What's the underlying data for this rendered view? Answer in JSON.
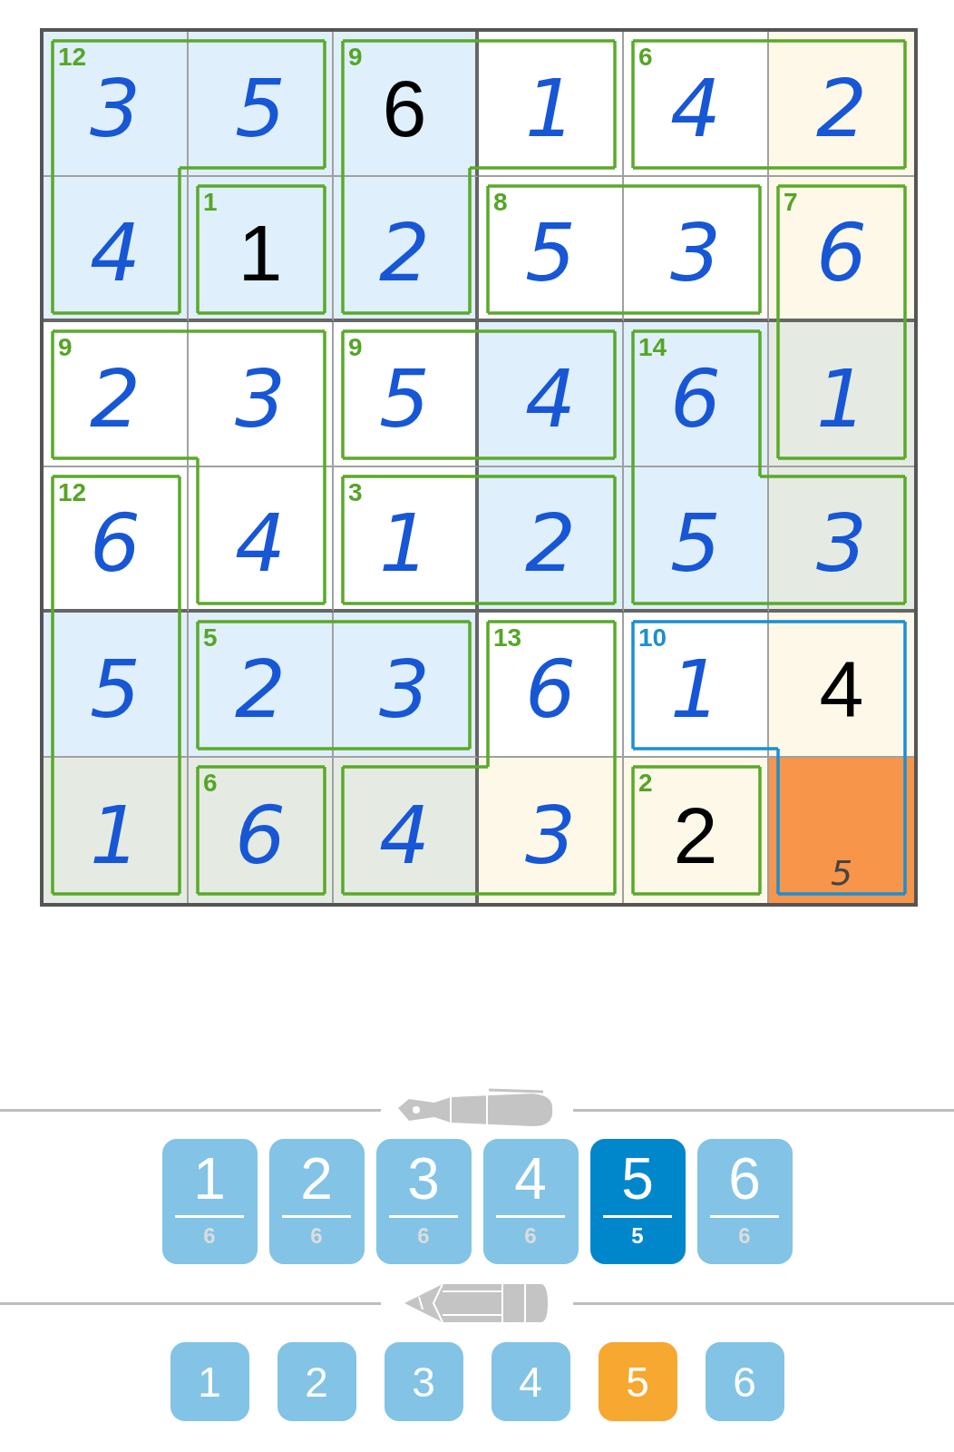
{
  "grid": {
    "rows": [
      [
        {
          "value": "3",
          "kind": "entry",
          "color": "#dfeffb",
          "cage_sum": "12",
          "joins_right": true,
          "joins_down": true,
          "cage_highlighted": false
        },
        {
          "value": "5",
          "kind": "entry",
          "color": "#dfeffb",
          "joins_right": false,
          "joins_down": false,
          "cage_highlighted": false
        },
        {
          "value": "6",
          "kind": "given",
          "color": "#dfeffb",
          "cage_sum": "9",
          "joins_right": true,
          "joins_down": true,
          "cage_highlighted": false
        },
        {
          "value": "1",
          "kind": "entry",
          "color": "#ffffff",
          "joins_right": false,
          "joins_down": false,
          "cage_highlighted": false
        },
        {
          "value": "4",
          "kind": "entry",
          "color": "#ffffff",
          "cage_sum": "6",
          "joins_right": true,
          "joins_down": false,
          "cage_highlighted": false
        },
        {
          "value": "2",
          "kind": "entry",
          "color": "#fdf8e8",
          "joins_down": false,
          "cage_highlighted": false
        }
      ],
      [
        {
          "value": "4",
          "kind": "entry",
          "color": "#dfeffb",
          "joins_right": false,
          "joins_down": false,
          "cage_highlighted": false
        },
        {
          "value": "1",
          "kind": "given",
          "color": "#dfeffb",
          "cage_sum": "1",
          "joins_right": false,
          "joins_down": false,
          "cage_highlighted": false
        },
        {
          "value": "2",
          "kind": "entry",
          "color": "#dfeffb",
          "joins_right": false,
          "joins_down": false,
          "cage_highlighted": false
        },
        {
          "value": "5",
          "kind": "entry",
          "color": "#ffffff",
          "cage_sum": "8",
          "joins_right": true,
          "joins_down": false,
          "cage_highlighted": false
        },
        {
          "value": "3",
          "kind": "entry",
          "color": "#ffffff",
          "joins_right": false,
          "joins_down": false,
          "cage_highlighted": false
        },
        {
          "value": "6",
          "kind": "entry",
          "color": "#fdf8e8",
          "cage_sum": "7",
          "joins_down": true,
          "cage_highlighted": false
        }
      ],
      [
        {
          "value": "2",
          "kind": "entry",
          "color": "#ffffff",
          "cage_sum": "9",
          "joins_right": true,
          "joins_down": false,
          "cage_highlighted": false
        },
        {
          "value": "3",
          "kind": "entry",
          "color": "#ffffff",
          "joins_right": false,
          "joins_down": true,
          "cage_highlighted": false
        },
        {
          "value": "5",
          "kind": "entry",
          "color": "#ffffff",
          "cage_sum": "9",
          "joins_right": true,
          "joins_down": false,
          "cage_highlighted": false
        },
        {
          "value": "4",
          "kind": "entry",
          "color": "#dfeffb",
          "joins_right": false,
          "joins_down": false,
          "cage_highlighted": false
        },
        {
          "value": "6",
          "kind": "entry",
          "color": "#dfeffb",
          "cage_sum": "14",
          "joins_right": false,
          "joins_down": true,
          "cage_highlighted": false
        },
        {
          "value": "1",
          "kind": "entry",
          "color": "#e5ebe3",
          "joins_down": false,
          "cage_highlighted": false
        }
      ],
      [
        {
          "value": "6",
          "kind": "entry",
          "color": "#ffffff",
          "cage_sum": "12",
          "joins_right": false,
          "joins_down": true,
          "cage_highlighted": false
        },
        {
          "value": "4",
          "kind": "entry",
          "color": "#ffffff",
          "joins_right": false,
          "joins_down": false,
          "cage_highlighted": false
        },
        {
          "value": "1",
          "kind": "entry",
          "color": "#ffffff",
          "cage_sum": "3",
          "joins_right": true,
          "joins_down": false,
          "cage_highlighted": false
        },
        {
          "value": "2",
          "kind": "entry",
          "color": "#dfeffb",
          "joins_right": false,
          "joins_down": false,
          "cage_highlighted": false
        },
        {
          "value": "5",
          "kind": "entry",
          "color": "#dfeffb",
          "joins_right": true,
          "joins_down": false,
          "cage_highlighted": false
        },
        {
          "value": "3",
          "kind": "entry",
          "color": "#e5ebe3",
          "joins_down": false,
          "cage_highlighted": false
        }
      ],
      [
        {
          "value": "5",
          "kind": "entry",
          "color": "#dfeffb",
          "joins_right": false,
          "joins_down": true,
          "cage_highlighted": false
        },
        {
          "value": "2",
          "kind": "entry",
          "color": "#dfeffb",
          "cage_sum": "5",
          "joins_right": true,
          "joins_down": false,
          "cage_highlighted": false
        },
        {
          "value": "3",
          "kind": "entry",
          "color": "#dfeffb",
          "joins_right": false,
          "joins_down": false,
          "cage_highlighted": false
        },
        {
          "value": "6",
          "kind": "entry",
          "color": "#ffffff",
          "cage_sum": "13",
          "joins_right": false,
          "joins_down": true,
          "cage_highlighted": false
        },
        {
          "value": "1",
          "kind": "entry",
          "color": "#ffffff",
          "cage_sum": "10",
          "joins_right": true,
          "joins_down": false,
          "cage_highlighted": true
        },
        {
          "value": "4",
          "kind": "given",
          "color": "#fdf8e8",
          "joins_down": true,
          "cage_highlighted": true
        }
      ],
      [
        {
          "value": "1",
          "kind": "entry",
          "color": "#e5ebe3",
          "joins_right": false,
          "cage_highlighted": false
        },
        {
          "value": "6",
          "kind": "entry",
          "color": "#e5ebe3",
          "cage_sum": "6",
          "joins_right": false,
          "cage_highlighted": false
        },
        {
          "value": "4",
          "kind": "entry",
          "color": "#e5ebe3",
          "joins_right": true,
          "cage_highlighted": false
        },
        {
          "value": "3",
          "kind": "entry",
          "color": "#fdf8e8",
          "joins_right": false,
          "cage_highlighted": false
        },
        {
          "value": "2",
          "kind": "given",
          "color": "#fdf8e8",
          "cage_sum": "2",
          "joins_right": false,
          "cage_highlighted": false
        },
        {
          "pencil": "5",
          "kind": "empty",
          "color": "#f7954a",
          "cage_highlighted": true
        }
      ]
    ]
  },
  "pen_buttons": [
    {
      "digit": "1",
      "count": "6",
      "selected": false
    },
    {
      "digit": "2",
      "count": "6",
      "selected": false
    },
    {
      "digit": "3",
      "count": "6",
      "selected": false
    },
    {
      "digit": "4",
      "count": "6",
      "selected": false
    },
    {
      "digit": "5",
      "count": "5",
      "selected": true
    },
    {
      "digit": "6",
      "count": "6",
      "selected": false
    }
  ],
  "pencil_buttons": [
    {
      "digit": "1",
      "selected": false
    },
    {
      "digit": "2",
      "selected": false
    },
    {
      "digit": "3",
      "selected": false
    },
    {
      "digit": "4",
      "selected": false
    },
    {
      "digit": "5",
      "selected": true
    },
    {
      "digit": "6",
      "selected": false
    }
  ]
}
